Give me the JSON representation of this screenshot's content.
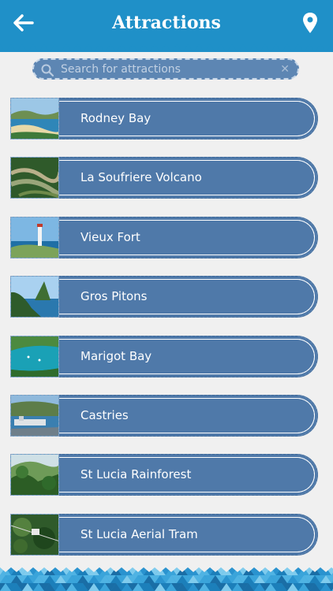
{
  "header": {
    "title": "Attractions",
    "back_icon": "arrow-left-icon",
    "map_icon": "map-pin-icon",
    "background_color": "#1f90c8"
  },
  "search": {
    "placeholder": "Search for attractions",
    "value": "",
    "icon": "search-icon",
    "clear_icon": "close-icon"
  },
  "attractions": [
    {
      "label": "Rodney Bay"
    },
    {
      "label": "La Soufriere Volcano"
    },
    {
      "label": "Vieux Fort"
    },
    {
      "label": "Gros Pitons"
    },
    {
      "label": "Marigot Bay"
    },
    {
      "label": "Castries"
    },
    {
      "label": "St Lucia Rainforest"
    },
    {
      "label": "St Lucia Aerial Tram"
    }
  ],
  "colors": {
    "item_background": "#4f79a9",
    "page_background": "#f0f0f0",
    "accent": "#1f90c8"
  }
}
